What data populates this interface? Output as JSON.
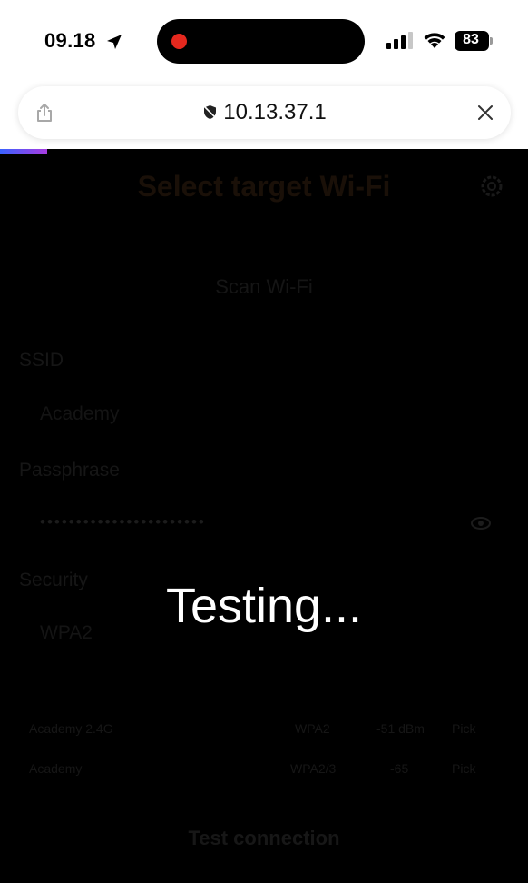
{
  "status_bar": {
    "time": "09.18",
    "battery": "83",
    "icons": [
      "location-arrow-icon",
      "cellular-signal-icon",
      "wifi-icon",
      "battery-icon"
    ],
    "recording_color": "#e5281e"
  },
  "browser": {
    "url": "10.13.37.1",
    "icons": [
      "share-icon",
      "shield-icon",
      "close-icon"
    ],
    "progress_gradient": [
      "#3a62ff",
      "#a83ce0"
    ]
  },
  "page": {
    "title": "Select target Wi-Fi",
    "scan_label": "Scan Wi-Fi",
    "ssid_label": "SSID",
    "ssid_value": "Academy",
    "passphrase_label": "Passphrase",
    "passphrase_mask": "•••••••••••••••••••••••",
    "security_label": "Security",
    "security_value": "WPA2",
    "networks": [
      {
        "ssid": "Academy 2.4G",
        "security": "WPA2",
        "signal": "-51 dBm",
        "action": "Pick"
      },
      {
        "ssid": "Academy",
        "security": "WPA2/3",
        "signal": "-65",
        "action": "Pick"
      }
    ],
    "test_label": "Test connection"
  },
  "overlay": {
    "message": "Testing..."
  }
}
